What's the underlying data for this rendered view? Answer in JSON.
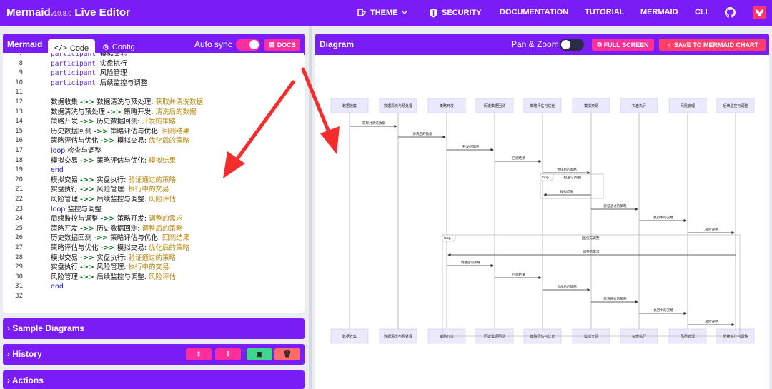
{
  "header": {
    "brand": "Mermaid",
    "version": "v10.8.0",
    "title": " Live Editor",
    "nav": [
      {
        "label": "THEME",
        "icon": "paint-bucket-icon"
      },
      {
        "label": "SECURITY",
        "icon": "shield-icon"
      },
      {
        "label": "DOCUMENTATION"
      },
      {
        "label": "TUTORIAL"
      },
      {
        "label": "MERMAID"
      },
      {
        "label": "CLI"
      }
    ],
    "github_icon": "github-icon",
    "mermaid_chart_icon": "mermaid-chart-logo-icon"
  },
  "editor_panel": {
    "title": "Mermaid",
    "tab_code": "Code",
    "tab_config": "Config",
    "auto_sync_label": "Auto sync",
    "auto_sync_on": true,
    "docs_label": "DOCS",
    "lines": [
      {
        "n": "7",
        "code": ""
      },
      {
        "n": "8",
        "code": ""
      },
      {
        "n": "9",
        "code": ""
      },
      {
        "n": "10",
        "code": ""
      },
      {
        "n": "11",
        "code": ""
      },
      {
        "n": "12",
        "code": ""
      },
      {
        "n": "13",
        "code": ""
      },
      {
        "n": "14",
        "code": ""
      },
      {
        "n": "15",
        "code": ""
      },
      {
        "n": "16",
        "code": ""
      },
      {
        "n": "17",
        "code": ""
      },
      {
        "n": "18",
        "code": ""
      },
      {
        "n": "19",
        "code": ""
      },
      {
        "n": "20",
        "code": ""
      },
      {
        "n": "21",
        "code": ""
      },
      {
        "n": "22",
        "code": ""
      },
      {
        "n": "23",
        "code": ""
      },
      {
        "n": "24",
        "code": ""
      },
      {
        "n": "25",
        "code": ""
      },
      {
        "n": "26",
        "code": ""
      },
      {
        "n": "27",
        "code": ""
      },
      {
        "n": "28",
        "code": ""
      },
      {
        "n": "29",
        "code": ""
      },
      {
        "n": "30",
        "code": ""
      },
      {
        "n": "31",
        "code": ""
      },
      {
        "n": "32",
        "code": ""
      }
    ],
    "code_parts": [
      [
        {
          "t": "participant ",
          "c": "kw"
        },
        {
          "t": "模拟交易",
          "c": ""
        }
      ],
      [
        {
          "t": "participant ",
          "c": "kw"
        },
        {
          "t": "实盘执行",
          "c": ""
        }
      ],
      [
        {
          "t": "participant ",
          "c": "kw"
        },
        {
          "t": "风险管理",
          "c": ""
        }
      ],
      [
        {
          "t": "participant ",
          "c": "kw"
        },
        {
          "t": "后续监控与调整",
          "c": ""
        }
      ],
      [],
      [
        {
          "t": "数据收集 ",
          "c": ""
        },
        {
          "t": "->> ",
          "c": "ar"
        },
        {
          "t": "数据清洗与预处理: ",
          "c": ""
        },
        {
          "t": "获取并清洗数据",
          "c": "msg"
        }
      ],
      [
        {
          "t": "数据清洗与预处理 ",
          "c": ""
        },
        {
          "t": "->> ",
          "c": "ar"
        },
        {
          "t": "策略开发: ",
          "c": ""
        },
        {
          "t": "清洗后的数据",
          "c": "msg"
        }
      ],
      [
        {
          "t": "策略开发 ",
          "c": ""
        },
        {
          "t": "->> ",
          "c": "ar"
        },
        {
          "t": "历史数据回测: ",
          "c": ""
        },
        {
          "t": "开发的策略",
          "c": "msg"
        }
      ],
      [
        {
          "t": "历史数据回测 ",
          "c": ""
        },
        {
          "t": "->> ",
          "c": "ar"
        },
        {
          "t": "策略评估与优化: ",
          "c": ""
        },
        {
          "t": "回测结果",
          "c": "msg"
        }
      ],
      [
        {
          "t": "策略评估与优化 ",
          "c": ""
        },
        {
          "t": "->> ",
          "c": "ar"
        },
        {
          "t": "模拟交易: ",
          "c": ""
        },
        {
          "t": "优化后的策略",
          "c": "msg"
        }
      ],
      [
        {
          "t": "loop ",
          "c": "kw2"
        },
        {
          "t": "检查与调整",
          "c": ""
        }
      ],
      [
        {
          "t": "      模拟交易 ",
          "c": ""
        },
        {
          "t": "->> ",
          "c": "ar"
        },
        {
          "t": "策略评估与优化: ",
          "c": ""
        },
        {
          "t": "模拟结果",
          "c": "msg"
        }
      ],
      [
        {
          "t": "end",
          "c": "kw2"
        }
      ],
      [
        {
          "t": "模拟交易 ",
          "c": ""
        },
        {
          "t": "->> ",
          "c": "ar"
        },
        {
          "t": "实盘执行: ",
          "c": ""
        },
        {
          "t": "验证通过的策略",
          "c": "msg"
        }
      ],
      [
        {
          "t": "实盘执行 ",
          "c": ""
        },
        {
          "t": "->> ",
          "c": "ar"
        },
        {
          "t": "风险管理: ",
          "c": ""
        },
        {
          "t": "执行中的交易",
          "c": "msg"
        }
      ],
      [
        {
          "t": "风险管理 ",
          "c": ""
        },
        {
          "t": "->> ",
          "c": "ar"
        },
        {
          "t": "后续监控与调整: ",
          "c": ""
        },
        {
          "t": "风险评估",
          "c": "msg"
        }
      ],
      [
        {
          "t": "loop ",
          "c": "kw2"
        },
        {
          "t": "监控与调整",
          "c": ""
        }
      ],
      [
        {
          "t": "      后续监控与调整 ",
          "c": ""
        },
        {
          "t": "->> ",
          "c": "ar"
        },
        {
          "t": "策略开发: ",
          "c": ""
        },
        {
          "t": "调整的需求",
          "c": "msg"
        }
      ],
      [
        {
          "t": "      策略开发 ",
          "c": ""
        },
        {
          "t": "->> ",
          "c": "ar"
        },
        {
          "t": "历史数据回测: ",
          "c": ""
        },
        {
          "t": "调整后的策略",
          "c": "msg"
        }
      ],
      [
        {
          "t": "      历史数据回测 ",
          "c": ""
        },
        {
          "t": "->> ",
          "c": "ar"
        },
        {
          "t": "策略评估与优化: ",
          "c": ""
        },
        {
          "t": "回测结果",
          "c": "msg"
        }
      ],
      [
        {
          "t": "      策略评估与优化 ",
          "c": ""
        },
        {
          "t": "->> ",
          "c": "ar"
        },
        {
          "t": "模拟交易: ",
          "c": ""
        },
        {
          "t": "优化后的策略",
          "c": "msg"
        }
      ],
      [
        {
          "t": "      模拟交易 ",
          "c": ""
        },
        {
          "t": "->> ",
          "c": "ar"
        },
        {
          "t": "实盘执行: ",
          "c": ""
        },
        {
          "t": "验证通过的策略",
          "c": "msg"
        }
      ],
      [
        {
          "t": "      实盘执行 ",
          "c": ""
        },
        {
          "t": "->> ",
          "c": "ar"
        },
        {
          "t": "风险管理: ",
          "c": ""
        },
        {
          "t": "执行中的交易",
          "c": "msg"
        }
      ],
      [
        {
          "t": "      风险管理 ",
          "c": ""
        },
        {
          "t": "->> ",
          "c": "ar"
        },
        {
          "t": "后续监控与调整: ",
          "c": ""
        },
        {
          "t": "风险评估",
          "c": "msg"
        }
      ],
      [
        {
          "t": "end",
          "c": "kw2"
        }
      ],
      []
    ]
  },
  "sections": {
    "sample_diagrams": "Sample Diagrams",
    "history": "History",
    "actions": "Actions"
  },
  "diagram_panel": {
    "title": "Diagram",
    "pan_zoom_label": "Pan & Zoom",
    "pan_zoom_on": false,
    "full_screen_label": "FULL SCREEN",
    "save_label": "SAVE TO MERMAID CHART"
  },
  "sequence": {
    "actors": [
      "数据收集",
      "数据清洗与预处理",
      "策略开发",
      "历史数据回测",
      "策略评估与优化",
      "模拟交易",
      "实盘执行",
      "风险管理",
      "后续监控与调整"
    ],
    "messages": [
      {
        "from": 0,
        "to": 1,
        "text": "获取并清洗数据"
      },
      {
        "from": 1,
        "to": 2,
        "text": "清洗后的数据"
      },
      {
        "from": 2,
        "to": 3,
        "text": "开发的策略"
      },
      {
        "from": 3,
        "to": 4,
        "text": "回测结果"
      },
      {
        "from": 4,
        "to": 5,
        "text": "优化后的策略"
      },
      {
        "from": 5,
        "to": 4,
        "text": "模拟结果"
      },
      {
        "from": 5,
        "to": 6,
        "text": "验证通过的策略"
      },
      {
        "from": 6,
        "to": 7,
        "text": "执行中的交易"
      },
      {
        "from": 7,
        "to": 8,
        "text": "风险评估"
      },
      {
        "from": 8,
        "to": 2,
        "text": "调整的需求"
      },
      {
        "from": 2,
        "to": 3,
        "text": "调整后的策略"
      },
      {
        "from": 3,
        "to": 4,
        "text": "回测结果"
      },
      {
        "from": 4,
        "to": 5,
        "text": "优化后的策略"
      },
      {
        "from": 5,
        "to": 6,
        "text": "验证通过的策略"
      },
      {
        "from": 6,
        "to": 7,
        "text": "执行中的交易"
      },
      {
        "from": 7,
        "to": 8,
        "text": "风险评估"
      }
    ],
    "loops": [
      {
        "keyword": "loop",
        "label": "[检查与调整]"
      },
      {
        "keyword": "loop",
        "label": "[监控与调整]"
      }
    ]
  },
  "colors": {
    "primary": "#7a1cf5",
    "pink": "#ff2e9a",
    "green": "#3dd68c",
    "red": "#ff6a6a",
    "annotation_arrow": "#f42c2c"
  }
}
